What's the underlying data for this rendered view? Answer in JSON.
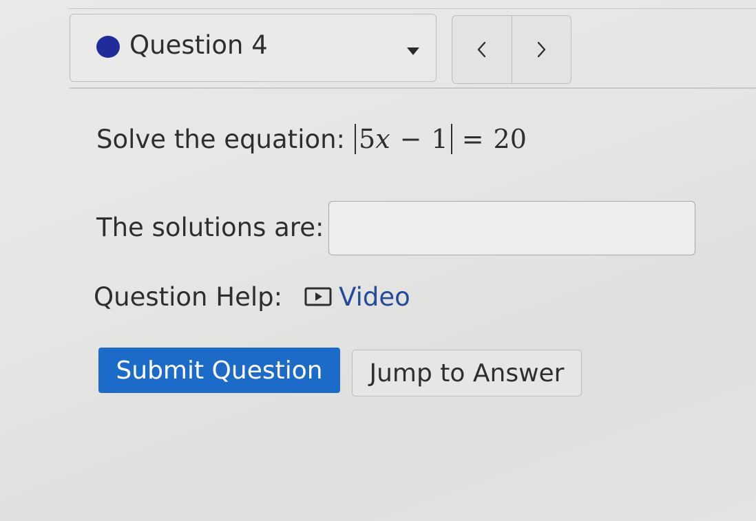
{
  "colors": {
    "status_dot": "#1f2c9a",
    "link": "#244a9c",
    "primary_button": "#1d6bc8",
    "text": "#2e2e2e"
  },
  "header": {
    "question_label": "Question 4",
    "dropdown_icon": "caret-down-icon",
    "prev_icon": "chevron-left-icon",
    "next_icon": "chevron-right-icon"
  },
  "question": {
    "prompt": "Solve the equation:",
    "equation": {
      "coefficient": "5",
      "variable": "x",
      "operator": "−",
      "constant": "1",
      "equals": "=",
      "rhs": "20"
    },
    "solutions_label": "The solutions are:",
    "answer_value": "",
    "answer_placeholder": ""
  },
  "help": {
    "label": "Question Help:",
    "video_icon": "play-video-icon",
    "video_label": "Video"
  },
  "actions": {
    "submit_label": "Submit Question",
    "jump_label": "Jump to Answer"
  }
}
